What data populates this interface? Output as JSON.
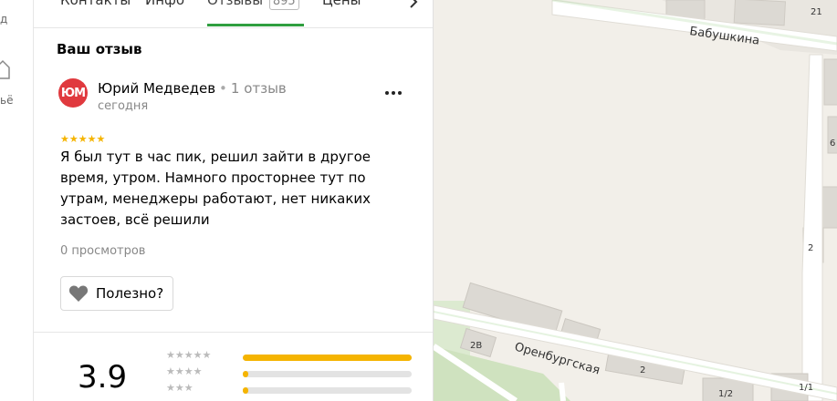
{
  "left_strip": {
    "top_text": "д",
    "bottom_text": "ьё"
  },
  "tabs": {
    "items": [
      {
        "label": "Контакты"
      },
      {
        "label": "Инфо"
      },
      {
        "label": "Отзывы",
        "count": "895"
      },
      {
        "label": "Цены"
      }
    ],
    "active_index": 2
  },
  "review": {
    "section_title": "Ваш отзыв",
    "avatar_initials": "ЮМ",
    "avatar_color": "#e0393e",
    "author": "Юрий Медведев",
    "author_reviews": "1 отзыв",
    "date": "сегодня",
    "stars": 5,
    "text": "Я был тут в час пик, решил зайти в другое время, утром. Намного просторнее тут по утрам, менеджеры работают, нет никаких застоев, всё решили",
    "views": "0 просмотров",
    "helpful_label": "Полезно?"
  },
  "rating": {
    "value": "3.9",
    "breakdown": [
      {
        "stars": 5,
        "fraction": 1.0
      },
      {
        "stars": 4,
        "fraction": 0.03
      },
      {
        "stars": 3,
        "fraction": 0.03
      }
    ],
    "accent_color": "#f5b400"
  },
  "map": {
    "street_top": "Бабушкина",
    "street_bottom": "Оренбургская",
    "house_labels": [
      "2В",
      "2",
      "1/2",
      "1/1",
      "21",
      "2",
      "6"
    ]
  }
}
